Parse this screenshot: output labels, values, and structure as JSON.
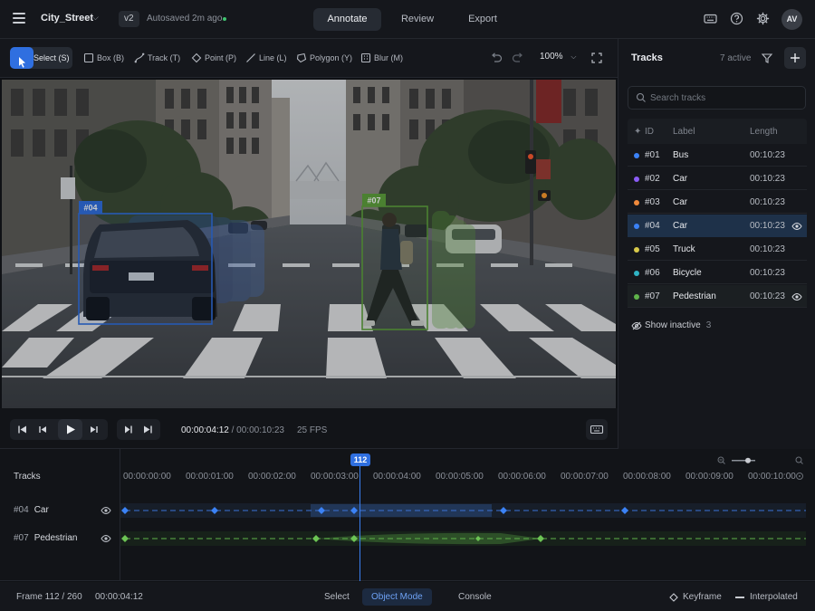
{
  "app": {
    "project_name": "City_Street",
    "version": "v2",
    "autosave": "Autosaved 2m ago",
    "avatar_initials": "AV"
  },
  "mode_tabs": [
    {
      "label": "Annotate",
      "active": true
    },
    {
      "label": "Review",
      "active": false
    },
    {
      "label": "Export",
      "active": false
    }
  ],
  "tools": [
    {
      "label": "Select (S)",
      "icon": "cursor-icon",
      "active": true
    },
    {
      "label": "Box (B)",
      "icon": "box-icon"
    },
    {
      "label": "Track (T)",
      "icon": "track-icon"
    },
    {
      "label": "Point (P)",
      "icon": "point-icon"
    },
    {
      "label": "Line (L)",
      "icon": "line-icon"
    },
    {
      "label": "Polygon (Y)",
      "icon": "polygon-icon"
    },
    {
      "label": "Blur (M)",
      "icon": "blur-icon"
    }
  ],
  "zoom": "100%",
  "canvas": {
    "boxes": [
      {
        "label": "#04",
        "color": "#2f6fe0"
      },
      {
        "label": "#07",
        "color": "#5ea23a"
      }
    ]
  },
  "player": {
    "current_time": "00:00:04:12",
    "total_time": "/ 00:00:10:23",
    "fps": "25 FPS"
  },
  "tracks_panel": {
    "title": "Tracks",
    "active_count": "7 active",
    "search_placeholder": "Search tracks",
    "columns": {
      "id": "ID",
      "label": "Label",
      "length": "Length"
    },
    "rows": [
      {
        "id": "#01",
        "label": "Bus",
        "length": "00:10:23",
        "color": "#3b82f6",
        "selected": false,
        "visible": false
      },
      {
        "id": "#02",
        "label": "Car",
        "length": "00:10:23",
        "color": "#8b5cf6",
        "selected": false,
        "visible": false
      },
      {
        "id": "#03",
        "label": "Car",
        "length": "00:10:23",
        "color": "#f08a3c",
        "selected": false,
        "visible": false
      },
      {
        "id": "#04",
        "label": "Car",
        "length": "00:10:23",
        "color": "#3b82f6",
        "selected": true,
        "visible": true
      },
      {
        "id": "#05",
        "label": "Truck",
        "length": "00:10:23",
        "color": "#d8c94a",
        "selected": false,
        "visible": false
      },
      {
        "id": "#06",
        "label": "Bicycle",
        "length": "00:10:23",
        "color": "#2fb3c4",
        "selected": false,
        "visible": false
      },
      {
        "id": "#07",
        "label": "Pedestrian",
        "length": "00:10:23",
        "color": "#5fb34a",
        "selected": false,
        "visible": true
      }
    ],
    "show_inactive_label": "Show inactive",
    "inactive_count": "3"
  },
  "timeline": {
    "title": "Tracks",
    "ruler": [
      "00:00:00:00",
      "00:00:01:00",
      "00:00:02:00",
      "00:00:03:00",
      "00:00:04:00",
      "00:00:05:00",
      "00:00:06:00",
      "00:00:07:00",
      "00:00:08:00",
      "00:00:09:00",
      "00:00:10:00"
    ],
    "playhead_frame": "112",
    "tracks": [
      {
        "id": "#04",
        "label": "Car",
        "color": "#3b82f6"
      },
      {
        "id": "#07",
        "label": "Pedestrian",
        "color": "#5fb34a"
      }
    ]
  },
  "statusbar": {
    "frame": "Frame 112 / 260",
    "time": "00:00:04:12",
    "modes": [
      {
        "label": "Select",
        "active": false
      },
      {
        "label": "Object Mode",
        "active": true
      },
      {
        "label": "Console",
        "active": false
      }
    ],
    "legend_keyframe": "Keyframe",
    "legend_interpolated": "Interpolated"
  }
}
